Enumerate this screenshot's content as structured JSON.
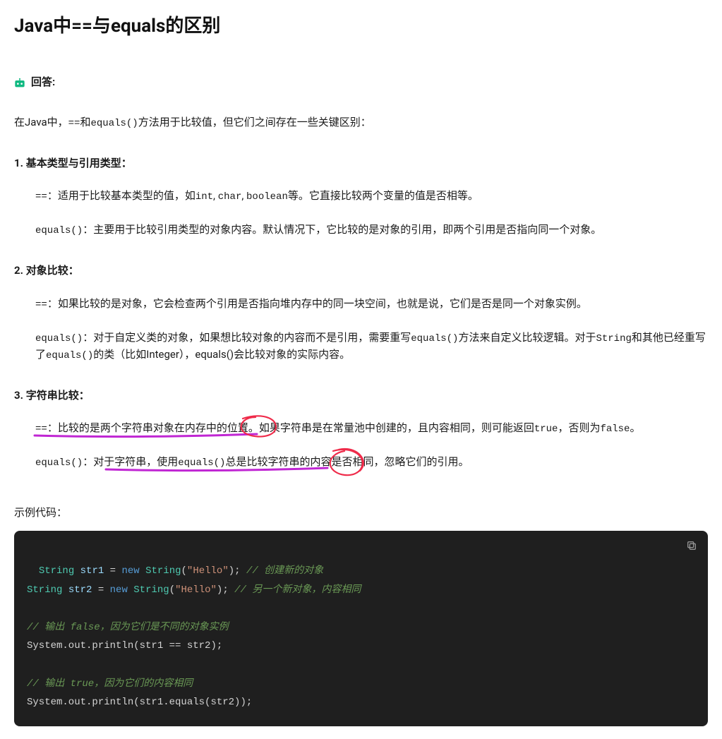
{
  "title": "Java中==与equals的区别",
  "answerLabel": "回答:",
  "intro_pre": "在Java中，",
  "intro_codeA": "==",
  "intro_mid": "和",
  "intro_codeB": "equals()",
  "intro_post": "方法用于比较值，但它们之间存在一些关键区别：",
  "points": [
    {
      "num": "1. ",
      "head": "基本类型与引用类型",
      "subs": [
        {
          "pre": "==",
          "text": "：适用于比较基本类型的值，如",
          "c1": "int",
          "c1sep": ", ",
          "c2": "char",
          "c2sep": ", ",
          "c3": "boolean",
          "tail": "等。它直接比较两个变量的值是否相等。"
        },
        {
          "pre": "equals()",
          "text": "：主要用于比较引用类型的对象内容。默认情况下，它比较的是对象的引用，即两个引用是否指向同一个对象。",
          "c1": "",
          "c1sep": "",
          "c2": "",
          "c2sep": "",
          "c3": "",
          "tail": ""
        }
      ]
    },
    {
      "num": "2. ",
      "head": "对象比较",
      "subs": [
        {
          "pre": "==",
          "text": "：如果比较的是对象，它会检查两个引用是否指向堆内存中的同一块空间，也就是说，它们是否是同一个对象实例。",
          "c1": "",
          "c1sep": "",
          "c2": "",
          "c2sep": "",
          "c3": "",
          "tail": ""
        },
        {
          "pre": "equals()",
          "text": "：对于自定义类的对象，如果想比较对象的内容而不是引用，需要重写",
          "c1": "equals()",
          "c1sep": "方法来自定义比较逻辑。对于",
          "c2": "String",
          "c2sep": "和其他已经重写了",
          "c3": "equals()",
          "tail": "的类（比如Integer），equals()会比较对象的实际内容。"
        }
      ]
    },
    {
      "num": "3. ",
      "head": "字符串比较",
      "subs": [
        {
          "pre": "==",
          "text": "：比较的是两个字符串对象在内存中的位置。如果字符串是在常量池中创建的，且内容相同，则可能返回",
          "c1": "true",
          "c1sep": "，否则为",
          "c2": "false",
          "c2sep": "。",
          "c3": "",
          "tail": ""
        },
        {
          "pre": "equals()",
          "text": "：对于字符串，使用",
          "c1": "equals()",
          "c1sep": "总是比较字符串的内容是否相同，忽略它们的引用。",
          "c2": "",
          "c2sep": "",
          "c3": "",
          "tail": ""
        }
      ]
    }
  ],
  "exampleLabel": "示例代码：",
  "code": {
    "line1": {
      "t_type": "String",
      "sp": " ",
      "t_var": "str1",
      "eq": " = ",
      "t_kw": "new",
      "sp2": " ",
      "t_cls": "String",
      "paren": "(",
      "t_str": "\"Hello\"",
      "cl": ");",
      "cmt": " // 创建新的对象"
    },
    "line2": {
      "t_type": "String",
      "sp": " ",
      "t_var": "str2",
      "eq": " = ",
      "t_kw": "new",
      "sp2": " ",
      "t_cls": "String",
      "paren": "(",
      "t_str": "\"Hello\"",
      "cl": ");",
      "cmt": " // 另一个新对象，内容相同"
    },
    "line3": "",
    "line4_cmt": "// 输出 false，因为它们是不同的对象实例",
    "line5": "System.out.println(str1 == str2);",
    "line6": "",
    "line7_cmt": "// 输出 true，因为它们的内容相同",
    "line8": "System.out.println(str1.equals(str2));"
  }
}
